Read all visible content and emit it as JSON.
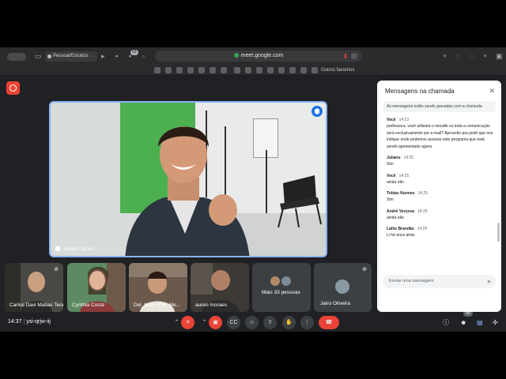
{
  "browser": {
    "profile_label": "Pessoal/Estudos",
    "tab_badge": "65",
    "url": "meet.google.com",
    "bookmarks_label": "Outros favoritos"
  },
  "meeting": {
    "time": "14:37",
    "separator": "|",
    "code": "ysi-qrjw-iij",
    "participant_count": "39",
    "main_speaker": "Jonata Carriel"
  },
  "tiles": [
    {
      "name": "Carlos Davi Matias Teodoro Cestar"
    },
    {
      "name": "Cynthia Costa"
    },
    {
      "name": "Del_Melo (Del_Me..."
    },
    {
      "name": "aureo moraes"
    },
    {
      "name": "Mais 33 pessoas"
    },
    {
      "name": "Jairo Oliveira"
    }
  ],
  "chat": {
    "title": "Mensagens na chamada",
    "recording_note": "As mensagens estão sendo gravadas com a chamada",
    "input_placeholder": "Enviar uma mensagem",
    "messages": [
      {
        "author": "Você",
        "time": "14:23",
        "text": "professora, você utilizará o moodle ou toda a comunicação será exclusivamente por e-mail? Aproveito pra pedir que nos indique onde podemos acessar este programa que está sendo apresentado agora"
      },
      {
        "author": "Juliano",
        "time": "14:25",
        "text": "Sim"
      },
      {
        "author": "Você",
        "time": "14:25",
        "text": "ainda não"
      },
      {
        "author": "Tobias Nunnes",
        "time": "14:25",
        "text": "Sim"
      },
      {
        "author": "André Verçosa",
        "time": "14:25",
        "text": "ainda não"
      },
      {
        "author": "Lahis Brandão",
        "time": "14:25",
        "text": "Li há anos atrás"
      }
    ]
  },
  "colors": {
    "accent_blue": "#8ab4f8",
    "danger_red": "#ea4335",
    "meet_bg": "#202124"
  }
}
